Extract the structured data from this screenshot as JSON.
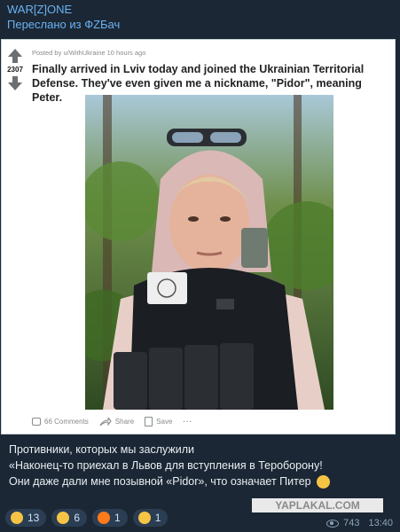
{
  "header": {
    "channel": "WAR[Z]ONE",
    "forwarded": "Переслано из ФZБач"
  },
  "post": {
    "score": "2307",
    "meta": "Posted by u/WithUkraine 10 hours ago",
    "title": "Finally arrived in Lviv today and joined the Ukrainian Territorial Defense. They've even given me a nickname, \"Pidor\", meaning Peter.",
    "comments": "66 Comments",
    "share": "Share",
    "save": "Save",
    "more": "···"
  },
  "message": {
    "line1": "Противники, которых мы заслужили",
    "line2": "«Наконец-то приехал в Львов для вступления в Тероборону!",
    "line3": "Они даже дали мне позывной «Pidor», что означает Питер"
  },
  "watermark": "YAPLAKAL.COM",
  "reactions": [
    {
      "icon": "thumbs-up-icon",
      "count": "13",
      "color": "#f6c445"
    },
    {
      "icon": "grimace-icon",
      "count": "6",
      "color": "#f6c445"
    },
    {
      "icon": "fire-icon",
      "count": "1",
      "color": "#ff7a1a"
    },
    {
      "icon": "thinking-icon",
      "count": "1",
      "color": "#f6c445"
    }
  ],
  "footer": {
    "views": "743",
    "time": "13:40"
  }
}
